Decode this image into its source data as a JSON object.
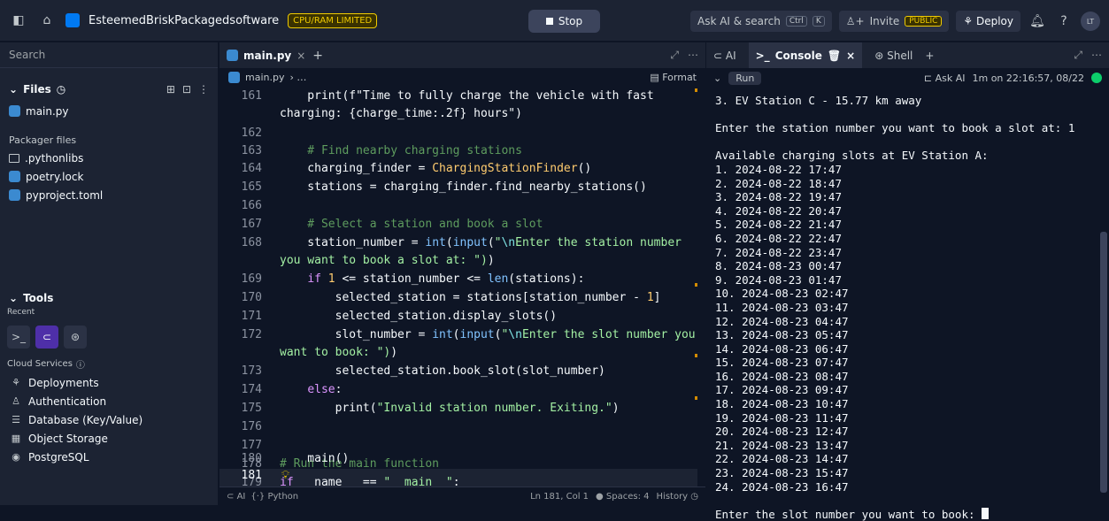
{
  "topbar": {
    "project": "EsteemedBriskPackagedsoftware",
    "badge": "CPU/RAM LIMITED",
    "stop": "Stop",
    "ask": "Ask AI & search",
    "kbd1": "Ctrl",
    "kbd2": "K",
    "invite": "Invite",
    "public": "PUBLIC",
    "deploy": "Deploy",
    "avatar": "LT"
  },
  "sidebar": {
    "search": "Search",
    "files_title": "Files",
    "items": [
      "main.py"
    ],
    "packager": "Packager files",
    "pkg_items": [
      ".pythonlibs",
      "poetry.lock",
      "pyproject.toml"
    ],
    "tools": "Tools",
    "recent": "Recent",
    "cloud": "Cloud Services",
    "services": [
      "Deployments",
      "Authentication",
      "Database (Key/Value)",
      "Object Storage",
      "PostgreSQL"
    ]
  },
  "editor": {
    "tab": "main.py",
    "crumb": "main.py",
    "format": "Format",
    "status_ai": "AI",
    "status_lang": "Python",
    "status_pos": "Ln 181, Col 1",
    "status_spaces": "Spaces: 4",
    "status_history": "History"
  },
  "console": {
    "tab_ai": "AI",
    "tab_console": "Console",
    "tab_shell": "Shell",
    "run": "Run",
    "ask_ai": "Ask AI",
    "time": "1m on 22:16:57, 08/22",
    "lines": [
      "3. EV Station C - 15.77 km away",
      "",
      "Enter the station number you want to book a slot at: 1",
      "",
      "Available charging slots at EV Station A:",
      "1. 2024-08-22 17:47",
      "2. 2024-08-22 18:47",
      "3. 2024-08-22 19:47",
      "4. 2024-08-22 20:47",
      "5. 2024-08-22 21:47",
      "6. 2024-08-22 22:47",
      "7. 2024-08-22 23:47",
      "8. 2024-08-23 00:47",
      "9. 2024-08-23 01:47",
      "10. 2024-08-23 02:47",
      "11. 2024-08-23 03:47",
      "12. 2024-08-23 04:47",
      "13. 2024-08-23 05:47",
      "14. 2024-08-23 06:47",
      "15. 2024-08-23 07:47",
      "16. 2024-08-23 08:47",
      "17. 2024-08-23 09:47",
      "18. 2024-08-23 10:47",
      "19. 2024-08-23 11:47",
      "20. 2024-08-23 12:47",
      "21. 2024-08-23 13:47",
      "22. 2024-08-23 14:47",
      "23. 2024-08-23 15:47",
      "24. 2024-08-23 16:47",
      "",
      "Enter the slot number you want to book: "
    ]
  }
}
